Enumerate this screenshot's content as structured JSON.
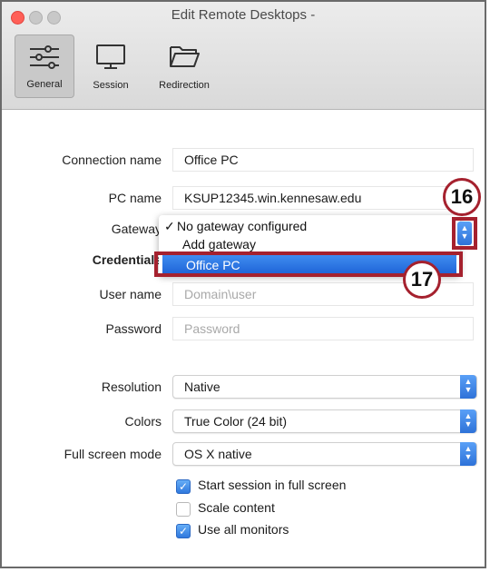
{
  "window": {
    "title": "Edit Remote Desktops -"
  },
  "toolbar": {
    "general": "General",
    "session": "Session",
    "redirection": "Redirection"
  },
  "form": {
    "connection_name": {
      "label": "Connection name",
      "value": "Office PC"
    },
    "pc_name": {
      "label": "PC name",
      "value": "KSUP12345.win.kennesaw.edu"
    },
    "gateway": {
      "label": "Gateway",
      "options": [
        "No gateway configured",
        "Add gateway",
        "Office PC"
      ],
      "checked_mark": "✓"
    },
    "credentials": {
      "label": "Credentials"
    },
    "user_name": {
      "label": "User name",
      "placeholder": "Domain\\user"
    },
    "password": {
      "label": "Password",
      "placeholder": "Password"
    },
    "resolution": {
      "label": "Resolution",
      "value": "Native"
    },
    "colors": {
      "label": "Colors",
      "value": "True Color (24 bit)"
    },
    "full_screen_mode": {
      "label": "Full screen mode",
      "value": "OS X native"
    },
    "checkboxes": [
      {
        "label": "Start session in full screen",
        "checked": true
      },
      {
        "label": "Scale content",
        "checked": false
      },
      {
        "label": "Use all monitors",
        "checked": true
      }
    ]
  },
  "callouts": {
    "first": "16",
    "second": "17"
  },
  "colors": {
    "callout": "#a5212e",
    "highlight": "#1d62d6",
    "stepper": "#2e72d8"
  }
}
